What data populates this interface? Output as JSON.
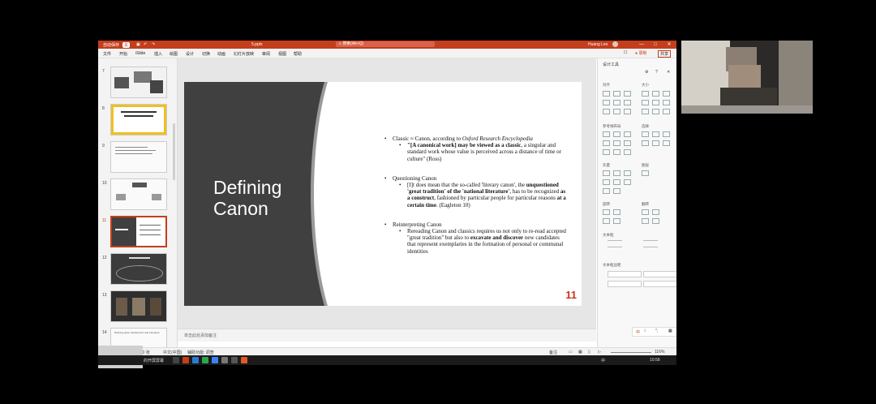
{
  "app": {
    "autosave_label": "自动保存",
    "autosave_state": "关",
    "file_name": "5.pptx",
    "search_placeholder": "搜索(Alt+Q)",
    "user_name": "Huang Leo",
    "window_controls": [
      "—",
      "□",
      "✕"
    ]
  },
  "menu": {
    "items": [
      "文件",
      "开始",
      "iSlide",
      "插入",
      "绘图",
      "设计",
      "切换",
      "动画",
      "幻灯片放映",
      "审阅",
      "视图",
      "帮助"
    ],
    "comment": "☐",
    "share_record": "● 录制",
    "share": "共享"
  },
  "thumbnails": {
    "numbers": [
      "7",
      "8",
      "9",
      "10",
      "11",
      "12",
      "13",
      "14"
    ],
    "selected": "11",
    "slide14_caption": "Defining place: Eudaimonic and Literature"
  },
  "slide": {
    "title": "Defining Canon",
    "number": "11",
    "b1": "Classic ≈ Canon, according to",
    "b1_source": "Oxford Research Encyclopedia",
    "b1_sub_bold": "\"[A canonical work] may be viewed as a classic",
    "b1_sub_rest": ", a singular and standard work whose value is perceived across a distance of time or culture\" (Ross)",
    "b2": "Questioning Canon",
    "b2_sub_a": "[I]t does mean that the so-called 'literary canon', the ",
    "b2_sub_b": "unquestioned 'great tradition' of the 'national literature'",
    "b2_sub_c": ", has to be recognized ",
    "b2_sub_d": "as a construct",
    "b2_sub_e": ", fashioned by particular people for particular reasons ",
    "b2_sub_f": "at a certain time",
    "b2_sub_g": ". (Eagleton 10)",
    "b3": "Reinterpreting Canon",
    "b3_sub_a": "Rereading Canon and classics requires us not only to re-read accepted \"great tradition\" but also to ",
    "b3_sub_b": "excavate and discover",
    "b3_sub_c": " new candidates that represent exemplaries in the formation of personal or communal identities"
  },
  "notes": {
    "placeholder": "单击此处添加备注"
  },
  "status": {
    "slide_info": "幻灯片 第 11 张，共 30 张",
    "lang": "中文(中国)",
    "accessibility": "辅助功能: 调查",
    "notes_btn": "备注",
    "zoom": "116%"
  },
  "design_panel": {
    "title": "设计工具",
    "sections": [
      "对齐",
      "大小",
      "参考线布局",
      "选择",
      "矢量",
      "图层",
      "旋转",
      "翻转",
      "文本框",
      "文本框边距"
    ]
  },
  "taskbar": {
    "app_label": "的开屏屏幕",
    "ime": "中",
    "time": "10:58"
  }
}
